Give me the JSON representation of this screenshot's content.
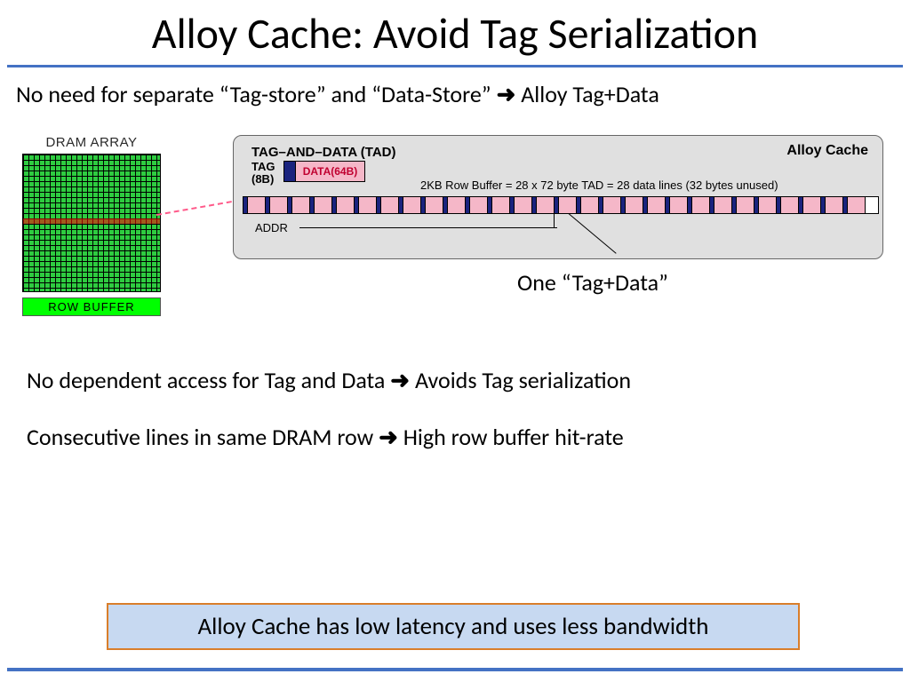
{
  "title": "Alloy Cache: Avoid Tag Serialization",
  "intro_before": "No need for separate “Tag-store” and “Data-Store” ",
  "intro_after": " Alloy Tag+Data",
  "arrow_glyph": "➜",
  "dram": {
    "array_label": "DRAM ARRAY",
    "row_buffer_label": "ROW BUFFER"
  },
  "alloy_panel": {
    "title": "Alloy Cache",
    "tad_label": "TAG–AND–DATA (TAD)",
    "tag_label_line1": "TAG",
    "tag_label_line2": "(8B)",
    "data_label": "DATA(64B)",
    "rowbuf_caption": "2KB Row Buffer = 28 x 72 byte TAD = 28 data lines (32 bytes unused)",
    "addr_label": "ADDR",
    "tad_count": 28
  },
  "one_tad": "One “Tag+Data”",
  "bullet1_before": "No dependent access for Tag and Data ",
  "bullet1_after": " Avoids Tag serialization",
  "bullet2_before": "Consecutive lines in same DRAM row  ",
  "bullet2_after": " High row buffer hit-rate",
  "conclusion": "Alloy Cache has low latency and uses less bandwidth"
}
